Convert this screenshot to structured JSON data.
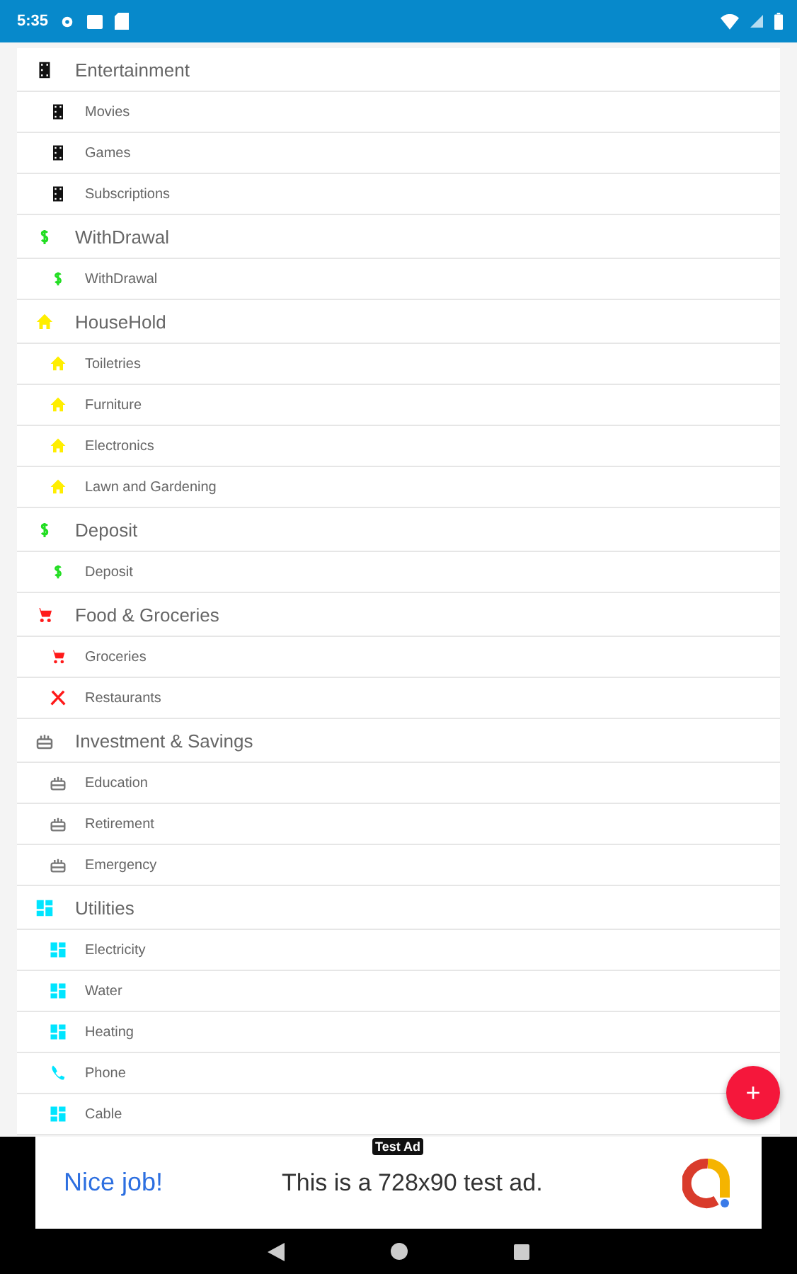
{
  "status_bar": {
    "time": "5:35"
  },
  "categories": [
    {
      "name": "Entertainment",
      "kind": "film",
      "color": "#111111",
      "children": [
        {
          "name": "Movies",
          "kind": "film",
          "color": "#111111"
        },
        {
          "name": "Games",
          "kind": "film",
          "color": "#111111"
        },
        {
          "name": "Subscriptions",
          "kind": "film",
          "color": "#111111"
        }
      ]
    },
    {
      "name": "WithDrawal",
      "kind": "dollar",
      "color": "#22dd22",
      "children": [
        {
          "name": "WithDrawal",
          "kind": "dollar",
          "color": "#22dd22"
        }
      ]
    },
    {
      "name": "HouseHold",
      "kind": "home",
      "color": "#ffee00",
      "children": [
        {
          "name": "Toiletries",
          "kind": "home",
          "color": "#ffee00"
        },
        {
          "name": "Furniture",
          "kind": "home",
          "color": "#ffee00"
        },
        {
          "name": "Electronics",
          "kind": "home",
          "color": "#ffee00"
        },
        {
          "name": "Lawn and Gardening",
          "kind": "home",
          "color": "#ffee00"
        }
      ]
    },
    {
      "name": "Deposit",
      "kind": "dollar",
      "color": "#22dd22",
      "children": [
        {
          "name": "Deposit",
          "kind": "dollar",
          "color": "#22dd22"
        }
      ]
    },
    {
      "name": "Food & Groceries",
      "kind": "cart",
      "color": "#ff1a1a",
      "children": [
        {
          "name": "Groceries",
          "kind": "cart",
          "color": "#ff1a1a"
        },
        {
          "name": "Restaurants",
          "kind": "cutlery",
          "color": "#ff1a1a"
        }
      ]
    },
    {
      "name": "Investment & Savings",
      "kind": "cake",
      "color": "#777777",
      "children": [
        {
          "name": "Education",
          "kind": "cake",
          "color": "#777777"
        },
        {
          "name": "Retirement",
          "kind": "cake",
          "color": "#777777"
        },
        {
          "name": "Emergency",
          "kind": "cake",
          "color": "#777777"
        }
      ]
    },
    {
      "name": "Utilities",
      "kind": "grid",
      "color": "#00e5ff",
      "children": [
        {
          "name": "Electricity",
          "kind": "grid",
          "color": "#00e5ff"
        },
        {
          "name": "Water",
          "kind": "grid",
          "color": "#00e5ff"
        },
        {
          "name": "Heating",
          "kind": "grid",
          "color": "#00e5ff"
        },
        {
          "name": "Phone",
          "kind": "phone",
          "color": "#00e5ff"
        },
        {
          "name": "Cable",
          "kind": "grid",
          "color": "#00e5ff"
        }
      ]
    }
  ],
  "fab": {
    "label": "+"
  },
  "ad": {
    "badge": "Test Ad",
    "headline": "Nice job!",
    "text": "This is a 728x90 test ad."
  }
}
